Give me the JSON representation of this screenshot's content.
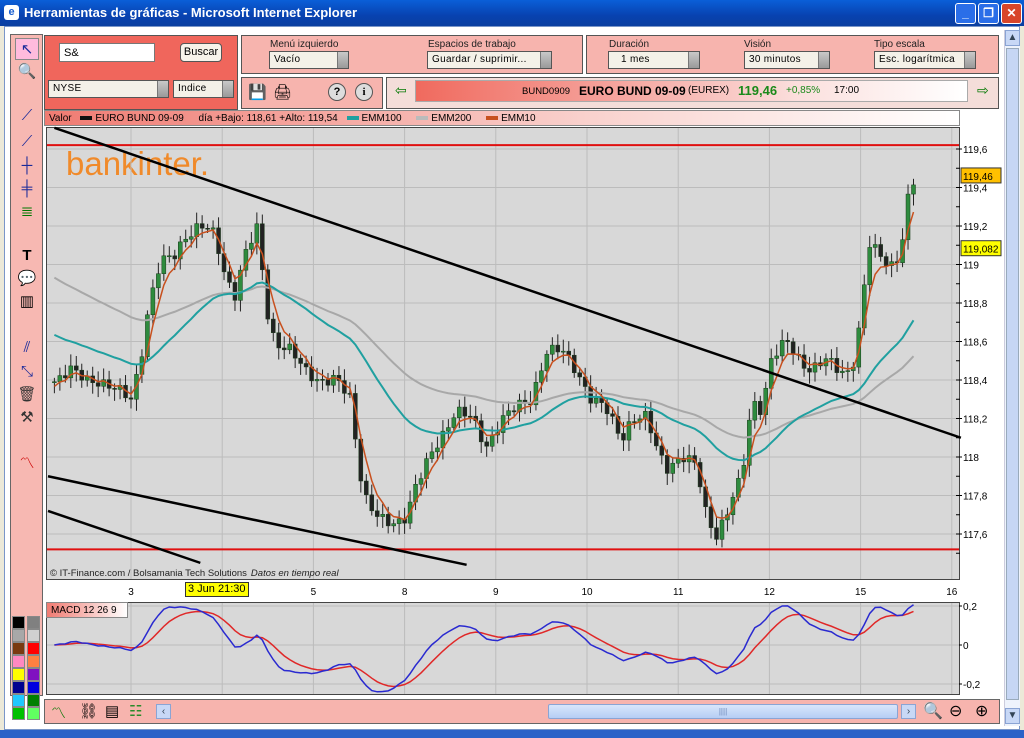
{
  "window": {
    "title": "Herramientas de gráficas - Microsoft Internet Explorer",
    "min": "_",
    "max": "❐",
    "close": "✕"
  },
  "search": {
    "value": "S&",
    "button": "Buscar",
    "market": "NYSE",
    "type": "Indice"
  },
  "menus": {
    "left_menu": {
      "label": "Menú izquierdo",
      "value": "Vacío"
    },
    "workspaces": {
      "label": "Espacios de trabajo",
      "value": "Guardar / suprimir..."
    },
    "duration": {
      "label": "Duración",
      "value": "1 mes"
    },
    "vision": {
      "label": "Visión",
      "value": "30 minutos"
    },
    "scale": {
      "label": "Tipo escala",
      "value": "Esc. logarítmica"
    }
  },
  "ticker": {
    "code": "BUND0909",
    "name": "EURO BUND 09-09",
    "exchange": "(EUREX)",
    "price": "119,46",
    "change": "+0,85%",
    "time": "17:00"
  },
  "legend": {
    "valor": "Valor",
    "series": "EURO BUND 09-09",
    "range": "día +Bajo: 118,61 +Alto: 119,54",
    "ema100": "EMM100",
    "ema200": "EMM200",
    "ema10": "EMM10"
  },
  "watermark": "bankinter.",
  "credits": {
    "source": "© IT-Finance.com / Bolsamania Tech Solutions",
    "realtime": "Datos en tiempo real"
  },
  "cursor_date": "3 Jun 21:30",
  "macd_label": "MACD 12 26 9",
  "colors": {
    "candle_up": "#2e8b3e",
    "candle_down": "#222222",
    "ema10": "#c8501e",
    "ema100": "#20a0a0",
    "ema200": "#a8a8a8",
    "macd": "#2a2ad0",
    "signal": "#e02828",
    "hline": "#e01010"
  },
  "chart_data": {
    "type": "candlestick",
    "x_ticks": [
      "3",
      "",
      "5",
      "8",
      "9",
      "10",
      "11",
      "12",
      "15",
      "16"
    ],
    "y_ticks": [
      "119,6",
      "119,4",
      "119,2",
      "119",
      "118,8",
      "118,6",
      "118,4",
      "118,2",
      "118",
      "117,8",
      "117,6"
    ],
    "y_tick_values": [
      119.6,
      119.4,
      119.2,
      119,
      118.8,
      118.6,
      118.4,
      118.2,
      118,
      117.8,
      117.6
    ],
    "ylim": [
      117.44,
      119.77
    ],
    "last_price_label": "119,46",
    "ema10_label": "119,082",
    "close_anchors": [
      [
        -0.84,
        118.4
      ],
      [
        -0.67,
        118.45
      ],
      [
        -0.5,
        118.4
      ],
      [
        -0.34,
        118.4
      ],
      [
        -0.18,
        118.35
      ],
      [
        0,
        118.3
      ],
      [
        0.1,
        118.5
      ],
      [
        0.2,
        118.8
      ],
      [
        0.32,
        119.0
      ],
      [
        0.48,
        119.05
      ],
      [
        0.59,
        119.15
      ],
      [
        0.76,
        119.2
      ],
      [
        0.92,
        119.15
      ],
      [
        1.03,
        118.95
      ],
      [
        1.14,
        118.85
      ],
      [
        1.25,
        119.05
      ],
      [
        1.4,
        119.2
      ],
      [
        1.47,
        118.8
      ],
      [
        1.58,
        118.6
      ],
      [
        1.75,
        118.55
      ],
      [
        1.9,
        118.45
      ],
      [
        2.08,
        118.4
      ],
      [
        2.24,
        118.4
      ],
      [
        2.41,
        118.3
      ],
      [
        2.5,
        117.95
      ],
      [
        2.57,
        117.8
      ],
      [
        2.68,
        117.7
      ],
      [
        2.79,
        117.65
      ],
      [
        2.9,
        117.65
      ],
      [
        3.01,
        117.7
      ],
      [
        3.12,
        117.85
      ],
      [
        3.23,
        117.95
      ],
      [
        3.4,
        118.1
      ],
      [
        3.56,
        118.25
      ],
      [
        3.73,
        118.2
      ],
      [
        3.89,
        118.05
      ],
      [
        4.06,
        118.2
      ],
      [
        4.22,
        118.25
      ],
      [
        4.39,
        118.3
      ],
      [
        4.55,
        118.55
      ],
      [
        4.72,
        118.55
      ],
      [
        4.89,
        118.45
      ],
      [
        5.05,
        118.3
      ],
      [
        5.2,
        118.25
      ],
      [
        5.38,
        118.1
      ],
      [
        5.49,
        118.2
      ],
      [
        5.65,
        118.2
      ],
      [
        5.76,
        118.05
      ],
      [
        5.87,
        117.95
      ],
      [
        6.04,
        118.0
      ],
      [
        6.2,
        117.95
      ],
      [
        6.31,
        117.7
      ],
      [
        6.42,
        117.6
      ],
      [
        6.53,
        117.7
      ],
      [
        6.7,
        117.9
      ],
      [
        6.81,
        118.3
      ],
      [
        6.92,
        118.25
      ],
      [
        7.02,
        118.5
      ],
      [
        7.19,
        118.6
      ],
      [
        7.35,
        118.5
      ],
      [
        7.46,
        118.45
      ],
      [
        7.63,
        118.5
      ],
      [
        7.79,
        118.45
      ],
      [
        7.9,
        118.45
      ],
      [
        8.0,
        118.7
      ],
      [
        8.09,
        119.1
      ],
      [
        8.22,
        119.05
      ],
      [
        8.33,
        119.0
      ],
      [
        8.44,
        119.05
      ],
      [
        8.5,
        119.3
      ],
      [
        8.6,
        119.45
      ]
    ],
    "ema_init": {
      "ema10": 118.35,
      "ema100": 118.65,
      "ema200": 118.95
    },
    "horizontal_lines": [
      119.62,
      117.52
    ],
    "trend_lines": [
      [
        [
          -0.84,
          119.71
        ],
        [
          9.1,
          118.1
        ]
      ],
      [
        [
          -0.91,
          117.9
        ],
        [
          3.68,
          117.44
        ]
      ],
      [
        [
          -0.91,
          117.72
        ],
        [
          0.76,
          117.45
        ]
      ]
    ],
    "macd": {
      "params": [
        12,
        26,
        9
      ],
      "y_ticks": [
        "0,2",
        "0",
        "-0,2"
      ],
      "ylim": [
        -0.24,
        0.24
      ]
    }
  }
}
